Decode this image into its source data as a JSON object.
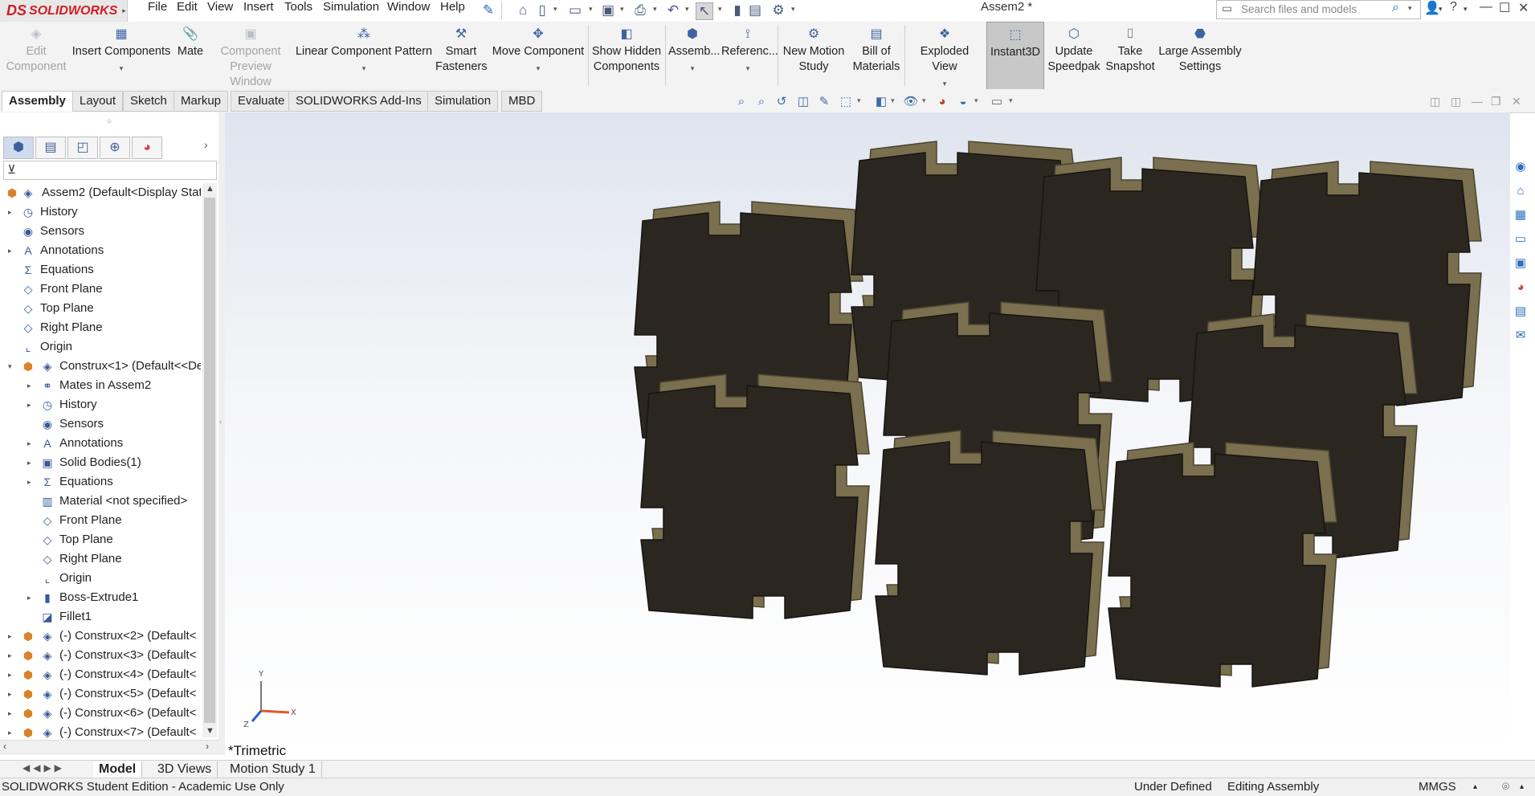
{
  "app": {
    "brand_ds": "DS",
    "brand_name": "SOLIDWORKS",
    "doc_title": "Assem2 *"
  },
  "menu": [
    "File",
    "Edit",
    "View",
    "Insert",
    "Tools",
    "Simulation",
    "Window",
    "Help"
  ],
  "search": {
    "placeholder": "Search files and models"
  },
  "commands": [
    {
      "label": "Edit Component",
      "icon": "edit-component-icon",
      "enabled": false
    },
    {
      "label": "Insert Components",
      "icon": "insert-components-icon",
      "enabled": true
    },
    {
      "label": "Mate",
      "icon": "mate-icon",
      "enabled": true
    },
    {
      "label": "Component Preview Window",
      "icon": "preview-window-icon",
      "enabled": false
    },
    {
      "label": "Linear Component Pattern",
      "icon": "linear-pattern-icon",
      "enabled": true
    },
    {
      "label": "Smart Fasteners",
      "icon": "smart-fasteners-icon",
      "enabled": true
    },
    {
      "label": "Move Component",
      "icon": "move-component-icon",
      "enabled": true
    },
    {
      "label": "Show Hidden Components",
      "icon": "show-hidden-icon",
      "enabled": true
    },
    {
      "label": "Assemb...",
      "icon": "assembly-features-icon",
      "enabled": true
    },
    {
      "label": "Referenc...",
      "icon": "reference-geometry-icon",
      "enabled": true
    },
    {
      "label": "New Motion Study",
      "icon": "motion-study-icon",
      "enabled": true
    },
    {
      "label": "Bill of Materials",
      "icon": "bom-icon",
      "enabled": true
    },
    {
      "label": "Exploded View",
      "icon": "exploded-view-icon",
      "enabled": true
    },
    {
      "label": "Instant3D",
      "icon": "instant3d-icon",
      "enabled": true,
      "active": true
    },
    {
      "label": "Update Speedpak",
      "icon": "speedpak-icon",
      "enabled": true
    },
    {
      "label": "Take Snapshot",
      "icon": "camera-icon",
      "enabled": true
    },
    {
      "label": "Large Assembly Settings",
      "icon": "large-assembly-icon",
      "enabled": true
    }
  ],
  "tabs": [
    "Assembly",
    "Layout",
    "Sketch",
    "Markup",
    "Evaluate",
    "SOLIDWORKS Add-Ins",
    "Simulation",
    "MBD"
  ],
  "tree": {
    "root": "Assem2  (Default<Display Stat",
    "items": [
      {
        "label": "History",
        "arrow": true
      },
      {
        "label": "Sensors",
        "arrow": false
      },
      {
        "label": "Annotations",
        "arrow": true
      },
      {
        "label": "Equations",
        "arrow": false
      },
      {
        "label": "Front Plane",
        "arrow": false
      },
      {
        "label": "Top Plane",
        "arrow": false
      },
      {
        "label": "Right Plane",
        "arrow": false
      },
      {
        "label": "Origin",
        "arrow": false
      },
      {
        "label": "Construx<1> (Default<<De",
        "arrow": true,
        "expanded": true
      },
      {
        "label": "Mates in Assem2",
        "arrow": true,
        "indent": 1
      },
      {
        "label": "History",
        "arrow": true,
        "indent": 1
      },
      {
        "label": "Sensors",
        "arrow": false,
        "indent": 1
      },
      {
        "label": "Annotations",
        "arrow": true,
        "indent": 1
      },
      {
        "label": "Solid Bodies(1)",
        "arrow": true,
        "indent": 1
      },
      {
        "label": "Equations",
        "arrow": true,
        "indent": 1
      },
      {
        "label": "Material <not specified>",
        "arrow": false,
        "indent": 1
      },
      {
        "label": "Front Plane",
        "arrow": false,
        "indent": 1
      },
      {
        "label": "Top Plane",
        "arrow": false,
        "indent": 1
      },
      {
        "label": "Right Plane",
        "arrow": false,
        "indent": 1
      },
      {
        "label": "Origin",
        "arrow": false,
        "indent": 1
      },
      {
        "label": "Boss-Extrude1",
        "arrow": true,
        "indent": 1
      },
      {
        "label": "Fillet1",
        "arrow": false,
        "indent": 1
      },
      {
        "label": "(-) Construx<2> (Default<",
        "arrow": true
      },
      {
        "label": "(-) Construx<3> (Default<",
        "arrow": true
      },
      {
        "label": "(-) Construx<4> (Default<",
        "arrow": true
      },
      {
        "label": "(-) Construx<5> (Default<",
        "arrow": true
      },
      {
        "label": "(-) Construx<6> (Default<",
        "arrow": true
      },
      {
        "label": "(-) Construx<7> (Default<",
        "arrow": true
      }
    ]
  },
  "viewport": {
    "view_name": "*Trimetric",
    "axis_x": "X",
    "axis_y": "Y",
    "axis_z": "Z",
    "part_color": "#2b2620",
    "edge_color": "#7a6f4e"
  },
  "bottom_tabs": [
    "Model",
    "3D Views",
    "Motion Study 1"
  ],
  "status": {
    "left": "SOLIDWORKS Student Edition - Academic Use Only",
    "state": "Under Defined",
    "mode": "Editing Assembly",
    "units": "MMGS"
  }
}
